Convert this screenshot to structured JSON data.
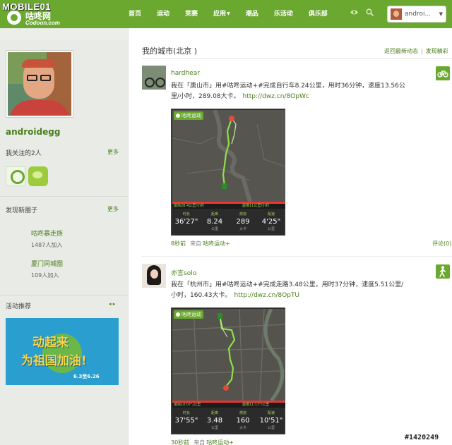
{
  "brand": {
    "watermark_text": "MOBILE01",
    "logo_cn": "咕咚网",
    "logo_en": "Codoon.com"
  },
  "nav": {
    "items": [
      {
        "label": "首页"
      },
      {
        "label": "运动"
      },
      {
        "label": "竞赛"
      },
      {
        "label": "应用",
        "dropdown": true
      },
      {
        "label": "潮品"
      },
      {
        "label": "乐活动"
      },
      {
        "label": "俱乐部"
      }
    ],
    "icons": [
      "eye-icon",
      "search-icon"
    ],
    "user_name": "androi...",
    "user_caret": "▼"
  },
  "sidebar": {
    "profile_name": "androidegg",
    "following": {
      "title": "我关注的2人",
      "more": "更多"
    },
    "circles": {
      "title": "发现新圈子",
      "more": "更多",
      "items": [
        {
          "name": "咕咚暴走族",
          "count": "1487人加入"
        },
        {
          "name": "厦门同城圈",
          "count": "109人加入"
        }
      ]
    },
    "activity": {
      "title": "活动推荐",
      "arrows": "◂ ▸",
      "banner_line1": "动起来",
      "banner_line2": "为祖国加油!",
      "banner_dates": "6.3至6.26"
    }
  },
  "main": {
    "title": "我的城市(北京 )",
    "back_link": "返回最新动态",
    "separator": "|",
    "highlights_link": "发现精彩",
    "posts": [
      {
        "user": "hardhear",
        "text": "我在「唐山市」用#咕咚运动+#完成自行车8.24公里，用时36分钟，速度13.56公里/小时，289.08大卡。",
        "url": "http://dwz.cn/8OpWc",
        "sport_icon": "bicycle-icon",
        "ago": "8秒前",
        "from_label": "来自",
        "source": "咕咚运动+",
        "comment": "评论(0)",
        "map": {
          "brand": "咕咚运动",
          "pace_min": "最快28.4公里/小时",
          "pace_max": "最慢11公里/小时",
          "stats": [
            {
              "label": "时长",
              "value": "36'27\"",
              "unit": ""
            },
            {
              "label": "距离",
              "value": "8.24",
              "unit": "公里"
            },
            {
              "label": "燃烧",
              "value": "289",
              "unit": "大卡"
            },
            {
              "label": "配速",
              "value": "4'25\"",
              "unit": "公里"
            }
          ]
        }
      },
      {
        "user": "亦言solo",
        "text": "我在「杭州市」用#咕咚运动+#完成走路3.48公里，用时37分钟，速度5.51公里/小时，160.43大卡。",
        "url": "http://dwz.cn/8OpTU",
        "sport_icon": "walking-icon",
        "ago": "30秒前",
        "from_label": "来自",
        "source": "咕咚运动+",
        "map": {
          "brand": "咕咚运动",
          "pace_min": "最快10'07\"/公里",
          "pace_max": "最慢11'17\"/公里",
          "stats": [
            {
              "label": "时长",
              "value": "37'55\"",
              "unit": ""
            },
            {
              "label": "距离",
              "value": "3.48",
              "unit": "公里"
            },
            {
              "label": "燃烧",
              "value": "160",
              "unit": "大卡"
            },
            {
              "label": "配速",
              "value": "10'51\"",
              "unit": "公里"
            }
          ]
        }
      }
    ]
  },
  "colors": {
    "brand_green": "#6aa82f",
    "link_green": "#4a7e1c",
    "route_green": "#8ee04a",
    "pin_red": "#e34b3b"
  },
  "page_watermark": "#1420249"
}
